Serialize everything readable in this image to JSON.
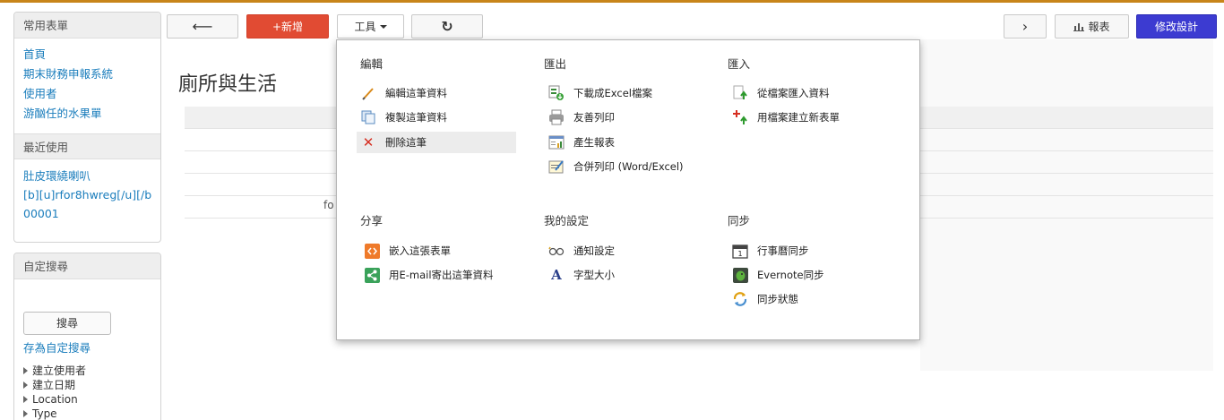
{
  "sidebar": {
    "common_forms": {
      "title": "常用表單",
      "items": [
        "首頁",
        "期末財務申報系統",
        "使用者",
        "游酗任的水果單"
      ]
    },
    "recent": {
      "title": "最近使用",
      "items": [
        "肚皮環繞喇叭",
        "[b][u]rfor8hwreg[/u][/b",
        "00001"
      ]
    },
    "custom_search": {
      "title": "自定搜尋",
      "search_button": "搜尋",
      "save_link": "存為自定搜尋",
      "filters": [
        "建立使用者",
        "建立日期",
        "Location",
        "Type"
      ]
    }
  },
  "toolbar": {
    "back_glyph": "⟵",
    "add_label": "+新增",
    "tools_label": "工具",
    "refresh_glyph": "↻",
    "next_glyph": "›",
    "report_label": "報表",
    "report_icon": "bar-chart-icon",
    "design_label": "修改設計"
  },
  "page": {
    "title": "廁所與生活",
    "cell_fragment": "fo"
  },
  "menu": {
    "groups": [
      {
        "title": "編輯",
        "items": [
          {
            "label": "編輯這筆資料",
            "icon": "pencil-icon"
          },
          {
            "label": "複製這筆資料",
            "icon": "copy-icon"
          },
          {
            "label": "刪除這筆",
            "icon": "delete-icon"
          }
        ]
      },
      {
        "title": "匯出",
        "items": [
          {
            "label": "下載成Excel檔案",
            "icon": "excel-download-icon"
          },
          {
            "label": "友善列印",
            "icon": "printer-icon"
          },
          {
            "label": "產生報表",
            "icon": "report-icon"
          },
          {
            "label": "合併列印 (Word/Excel)",
            "icon": "merge-print-icon"
          }
        ]
      },
      {
        "title": "匯入",
        "items": [
          {
            "label": "從檔案匯入資料",
            "icon": "import-file-icon"
          },
          {
            "label": "用檔案建立新表單",
            "icon": "new-form-from-file-icon"
          }
        ]
      },
      {
        "title": "分享",
        "items": [
          {
            "label": "嵌入這張表單",
            "icon": "embed-icon"
          },
          {
            "label": "用E-mail寄出這筆資料",
            "icon": "share-icon"
          }
        ]
      },
      {
        "title": "我的設定",
        "items": [
          {
            "label": "通知設定",
            "icon": "glasses-icon"
          },
          {
            "label": "字型大小",
            "icon": "font-size-icon"
          }
        ]
      },
      {
        "title": "同步",
        "items": [
          {
            "label": "行事曆同步",
            "icon": "calendar-icon"
          },
          {
            "label": "Evernote同步",
            "icon": "evernote-icon"
          },
          {
            "label": "同步狀態",
            "icon": "sync-icon"
          }
        ]
      }
    ]
  },
  "colors": {
    "accent_top": "#c8851a",
    "add_button": "#e14b33",
    "design_button": "#3c3bd1",
    "link": "#1a7dbc"
  }
}
